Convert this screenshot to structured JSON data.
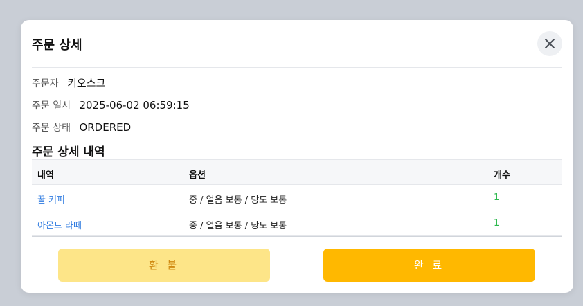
{
  "modal": {
    "title": "주문 상세",
    "close_icon": "close-icon"
  },
  "info": {
    "orderer_label": "주문자",
    "orderer_value": "키오스크",
    "date_label": "주문 일시",
    "date_value": "2025-06-02 06:59:15",
    "status_label": "주문 상태",
    "status_value": "ORDERED"
  },
  "details": {
    "title": "주문 상세 내역",
    "headers": [
      "내역",
      "옵션",
      "개수"
    ],
    "rows": [
      {
        "name": "꿀 커피",
        "options": "중 / 얼음 보통 / 당도 보통",
        "qty": "1"
      },
      {
        "name": "아몬드 라떼",
        "options": "중 / 얼음 보통 / 당도 보통",
        "qty": "1"
      }
    ]
  },
  "actions": {
    "refund_label": "환 불",
    "complete_label": "완 료"
  },
  "colors": {
    "accent": "#ffb800",
    "refund_bg": "#fde588",
    "link": "#2f7be0",
    "qty": "#2db84d"
  }
}
